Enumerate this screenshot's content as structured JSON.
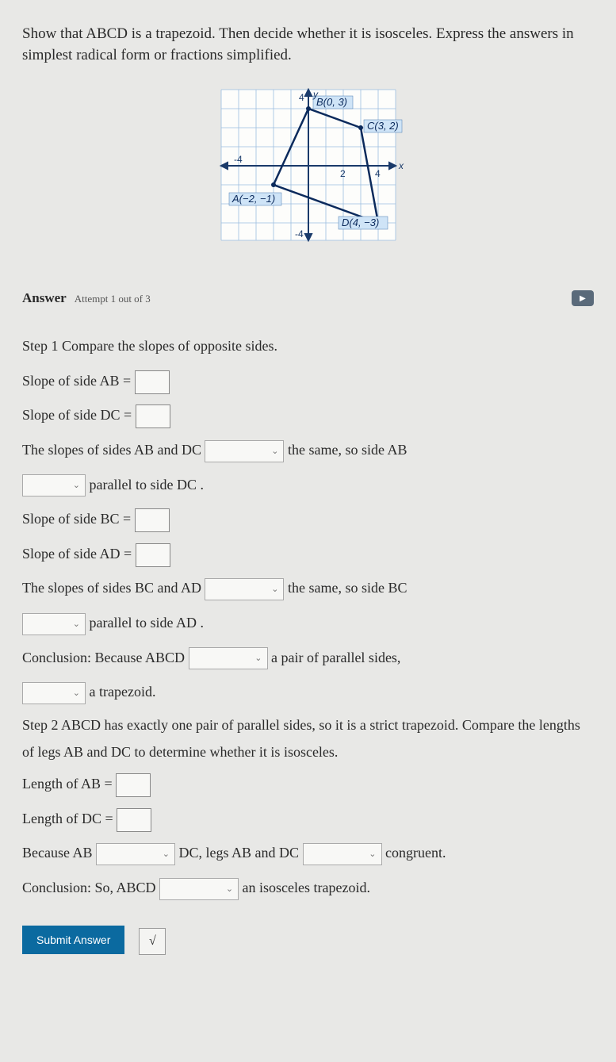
{
  "question": "Show that ABCD is a trapezoid. Then decide whether it is isosceles. Express the answers in simplest radical form or fractions simplified.",
  "graph": {
    "points": {
      "A": {
        "label": "A(−2, −1)",
        "x": -2,
        "y": -1
      },
      "B": {
        "label": "B(0, 3)",
        "x": 0,
        "y": 3
      },
      "C": {
        "label": "C(3, 2)",
        "x": 3,
        "y": 2
      },
      "D": {
        "label": "D(4, −3)",
        "x": 4,
        "y": -3
      }
    },
    "axis": {
      "y_label": "y",
      "x_label": "x",
      "ticks": {
        "ytop": "4",
        "ybottom": "-4",
        "xleft": "-4",
        "xr1": "2",
        "xr2": "4"
      }
    }
  },
  "answer": {
    "label": "Answer",
    "attempt": "Attempt 1 out of 3"
  },
  "step1": {
    "title": "Step 1 Compare the slopes of opposite sides.",
    "slope_ab_label": "Slope of side AB =",
    "slope_dc_label": "Slope of side DC =",
    "cmp1_pre": "The slopes of sides AB and DC",
    "cmp1_post": "the same, so side AB",
    "par1": "parallel to side DC .",
    "slope_bc_label": "Slope of side BC =",
    "slope_ad_label": "Slope of side AD =",
    "cmp2_pre": "The slopes of sides BC and AD",
    "cmp2_post": "the same, so side BC",
    "par2": "parallel to side AD .",
    "concl_pre": "Conclusion: Because ABCD",
    "concl_mid": "a pair of parallel sides,",
    "concl_post": "a trapezoid."
  },
  "step2": {
    "intro": "Step 2 ABCD has exactly one pair of parallel sides, so it is a strict trapezoid. Compare the lengths of legs AB and DC to determine whether it is isosceles.",
    "len_ab_label": "Length of AB =",
    "len_dc_label": "Length of DC =",
    "because_pre": "Because AB",
    "because_mid": "DC, legs AB and DC",
    "because_post": "congruent.",
    "concl_pre": "Conclusion: So, ABCD",
    "concl_post": "an isosceles trapezoid."
  },
  "submit": "Submit Answer",
  "sqrt_symbol": "√"
}
